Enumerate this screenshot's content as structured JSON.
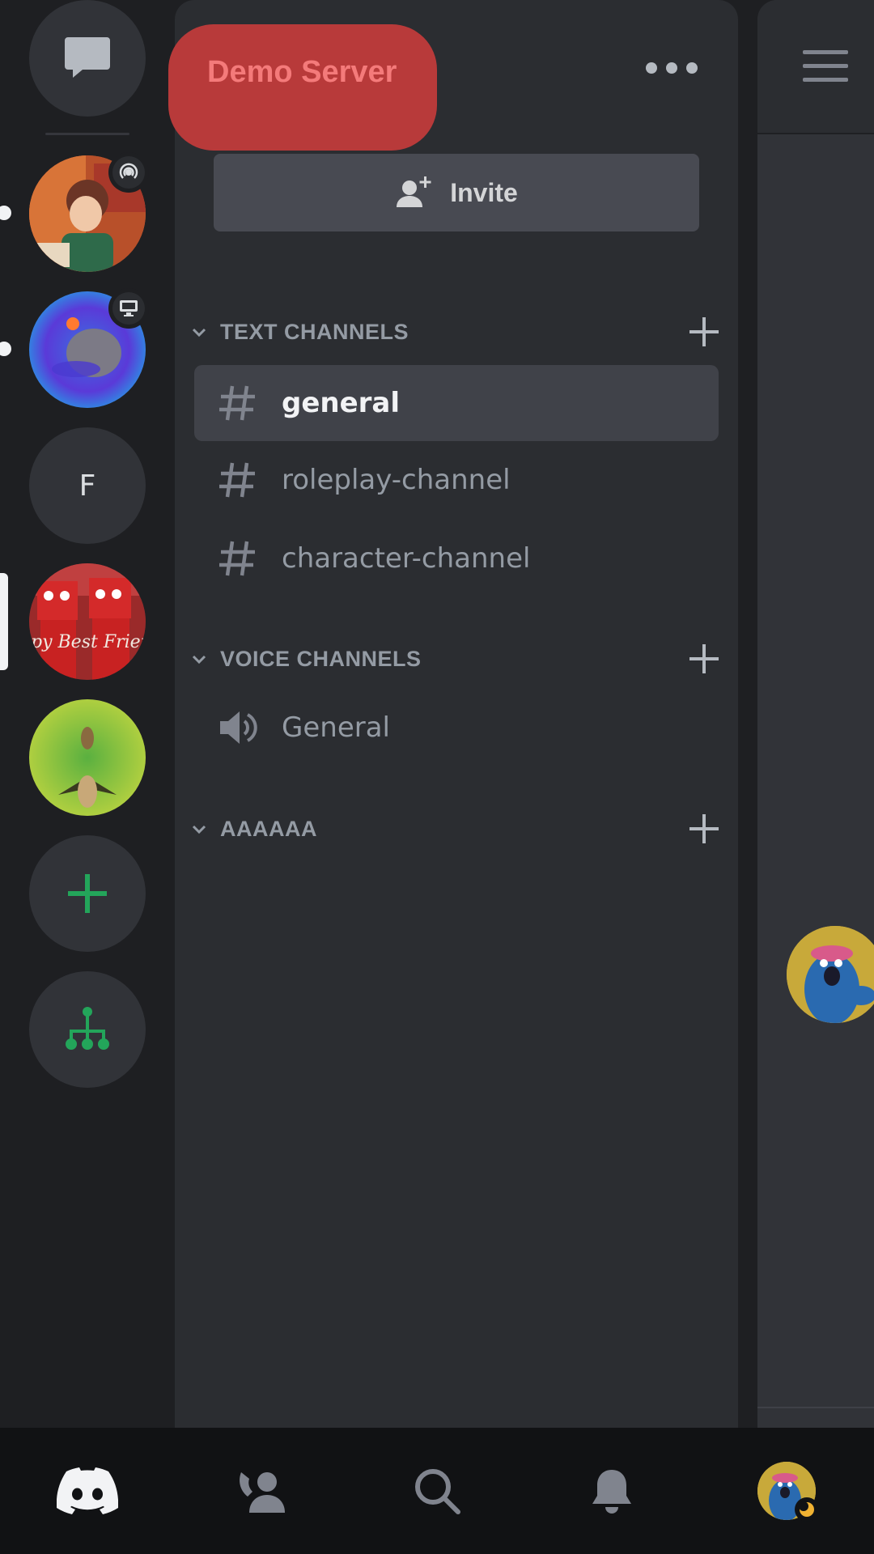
{
  "server": {
    "name": "Demo Server",
    "invite_label": "Invite"
  },
  "rail": {
    "items": [
      {
        "name": "direct-messages",
        "icon": "chat-bubble-icon"
      },
      {
        "name": "server-1",
        "icon": "server-avatar",
        "badge": "stage-broadcast-icon",
        "unread": true
      },
      {
        "name": "server-2",
        "icon": "server-avatar",
        "badge": "screen-share-icon",
        "unread": true
      },
      {
        "name": "server-f",
        "letter": "F"
      },
      {
        "name": "server-demo",
        "icon": "server-avatar",
        "selected": true
      },
      {
        "name": "server-5",
        "icon": "server-avatar"
      },
      {
        "name": "add-server",
        "icon": "plus-icon"
      },
      {
        "name": "discover",
        "icon": "hub-icon"
      }
    ]
  },
  "categories": [
    {
      "label": "TEXT CHANNELS"
    },
    {
      "label": "VOICE CHANNELS"
    },
    {
      "label": "AAAAAA"
    }
  ],
  "text_channels": [
    {
      "name": "general",
      "selected": true
    },
    {
      "name": "roleplay-channel",
      "selected": false
    },
    {
      "name": "character-channel",
      "selected": false
    }
  ],
  "voice_channels": [
    {
      "name": "General"
    }
  ],
  "nav": {
    "items": [
      "home-icon",
      "friends-icon",
      "search-icon",
      "notifications-icon",
      "profile-avatar"
    ]
  },
  "colors": {
    "accent_green": "#23a55a",
    "server_highlight": "#b83a3a",
    "server_name_text": "#f47a7a"
  }
}
